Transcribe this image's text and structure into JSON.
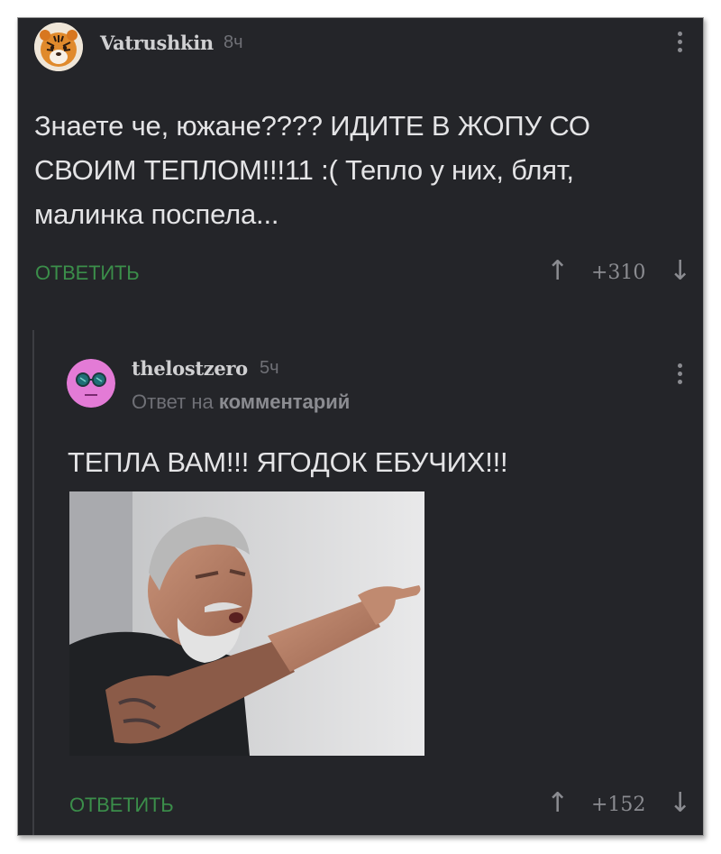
{
  "comments": [
    {
      "username": "Vatrushkin",
      "time": "8ч",
      "text": "Знаете че, южане???? ИДИТЕ В ЖОПУ СО СВОИМ ТЕПЛОМ!!!11 :( Тепло у них, блят, малинка поспела...",
      "reply_label": "ОТВЕТИТЬ",
      "rating": "+310",
      "avatar_icon": "tiger-avatar-icon"
    },
    {
      "username": "thelostzero",
      "time": "5ч",
      "reply_to_prefix": "Ответ на",
      "reply_to_link": "комментарий",
      "text": "ТЕПЛА ВАМ!!! ЯГОДОК ЕБУЧИХ!!!",
      "reply_label": "ОТВЕТИТЬ",
      "rating": "+152",
      "avatar_icon": "pink-face-avatar-icon"
    }
  ],
  "icons": {
    "upvote": "↑",
    "downvote": "↓"
  },
  "colors": {
    "background": "#242529",
    "reply_button": "#3b8e4a",
    "text": "#e4e4e6",
    "avatar2": "#e37bd6"
  }
}
